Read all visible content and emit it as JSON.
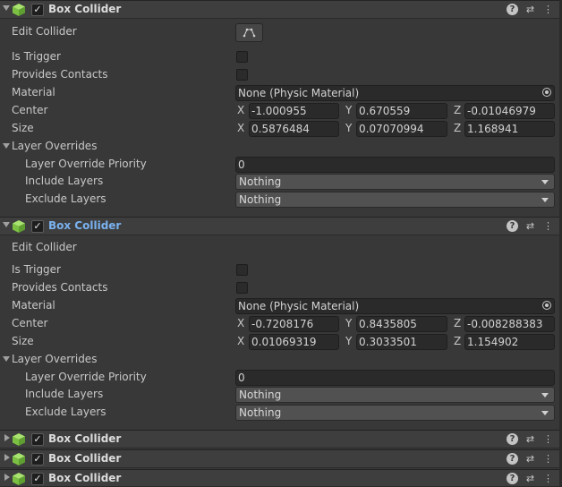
{
  "components": [
    {
      "title": "Box Collider",
      "expanded": true,
      "selected": false,
      "enabled_check": "✓",
      "edit_collider_label": "Edit Collider",
      "is_trigger_label": "Is Trigger",
      "provides_contacts_label": "Provides Contacts",
      "material_label": "Material",
      "material_value": "None (Physic Material)",
      "center_label": "Center",
      "center": {
        "x": "-1.000955",
        "y": "0.670559",
        "z": "-0.01046979"
      },
      "size_label": "Size",
      "size": {
        "x": "0.5876484",
        "y": "0.07070994",
        "z": "1.168941"
      },
      "layer_overrides_label": "Layer Overrides",
      "priority_label": "Layer Override Priority",
      "priority_value": "0",
      "include_label": "Include Layers",
      "include_value": "Nothing",
      "exclude_label": "Exclude Layers",
      "exclude_value": "Nothing"
    },
    {
      "title": "Box Collider",
      "expanded": true,
      "selected": true,
      "enabled_check": "✓",
      "edit_collider_label": "Edit Collider",
      "is_trigger_label": "Is Trigger",
      "provides_contacts_label": "Provides Contacts",
      "material_label": "Material",
      "material_value": "None (Physic Material)",
      "center_label": "Center",
      "center": {
        "x": "-0.7208176",
        "y": "0.8435805",
        "z": "-0.008288383"
      },
      "size_label": "Size",
      "size": {
        "x": "0.01069319",
        "y": "0.3033501",
        "z": "1.154902"
      },
      "layer_overrides_label": "Layer Overrides",
      "priority_label": "Layer Override Priority",
      "priority_value": "0",
      "include_label": "Include Layers",
      "include_value": "Nothing",
      "exclude_label": "Exclude Layers",
      "exclude_value": "Nothing"
    },
    {
      "title": "Box Collider",
      "expanded": false,
      "enabled_check": "✓"
    },
    {
      "title": "Box Collider",
      "expanded": false,
      "enabled_check": "✓"
    },
    {
      "title": "Box Collider",
      "expanded": false,
      "enabled_check": "✓"
    }
  ],
  "axis_labels": {
    "x": "X",
    "y": "Y",
    "z": "Z"
  },
  "header_icons": {
    "help": "?",
    "presets": "⇄",
    "menu": "⋮"
  },
  "icon_names": [
    "fold-triangle-icon",
    "box-collider-cube-icon",
    "help-icon",
    "presets-icon",
    "context-menu-icon",
    "edit-collider-icon",
    "object-picker-icon",
    "dropdown-caret-icon"
  ],
  "colors": {
    "background": "#383838",
    "header": "#3e3e3e",
    "selected_title": "#7ab2f0",
    "cube_icon": "#8fd14f"
  }
}
